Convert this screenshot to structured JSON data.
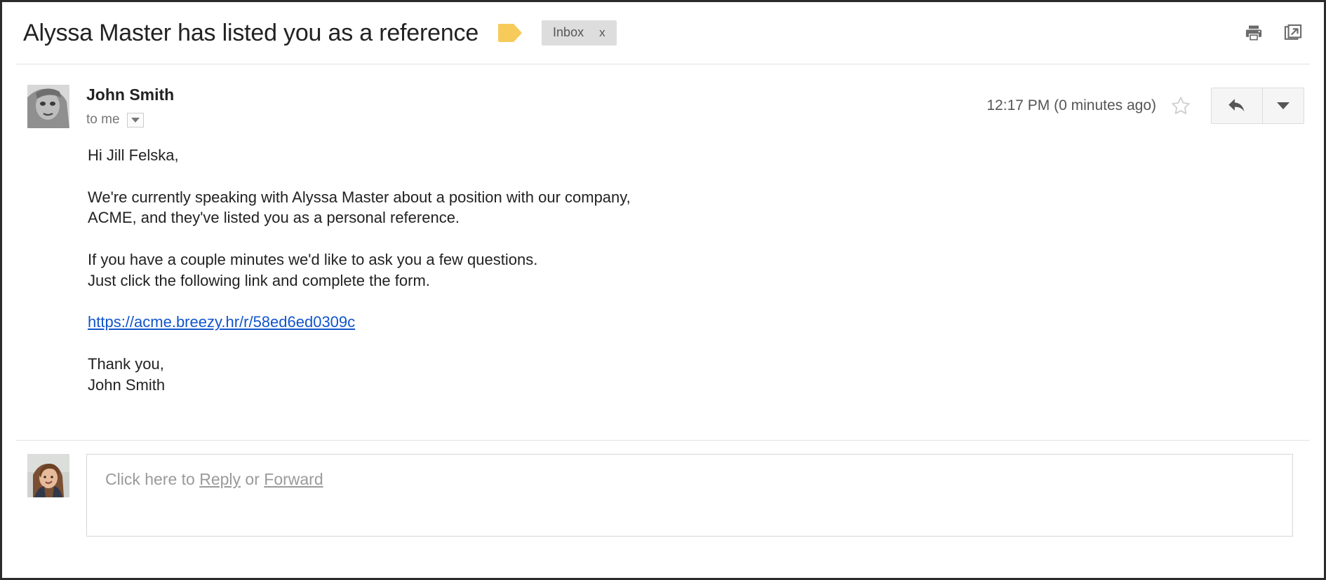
{
  "header": {
    "subject": "Alyssa Master has listed you as a reference",
    "label_icon": "label-tag-icon",
    "inbox_chip": {
      "label": "Inbox",
      "remove": "x"
    },
    "actions": [
      {
        "name": "print-icon",
        "title": "Print"
      },
      {
        "name": "open-in-new-window-icon",
        "title": "Open in new window"
      }
    ]
  },
  "message": {
    "sender_name": "John Smith",
    "recipient": "to me",
    "recipient_caret": "details-caret-icon",
    "timestamp": "12:17 PM (0 minutes ago)",
    "star_icon": "star-outline-icon",
    "reply_icon": "reply-arrow-icon",
    "more_icon": "caret-down-icon",
    "avatar": "sender-avatar",
    "body": {
      "greeting": "Hi Jill Felska,",
      "paragraph_1": "We're currently speaking with Alyssa Master about a position with our company, ACME, and they've listed you as a personal reference.",
      "paragraph_2_line_1": "If you have a couple minutes we'd like to ask you a few questions.",
      "paragraph_2_line_2": "Just click the following link and complete the form.",
      "link": "https://acme.breezy.hr/r/58ed6ed0309c",
      "signoff_line_1": "Thank you,",
      "signoff_line_2": "John Smith"
    }
  },
  "reply": {
    "avatar": "user-avatar",
    "prompt_prefix": "Click here to ",
    "reply_label": "Reply",
    "or_label": " or ",
    "forward_label": "Forward"
  },
  "colors": {
    "link": "#1155cc",
    "label_yellow": "#f7cb5a",
    "chip_bg": "#dddddd",
    "text": "#222222",
    "muted": "#777777"
  }
}
